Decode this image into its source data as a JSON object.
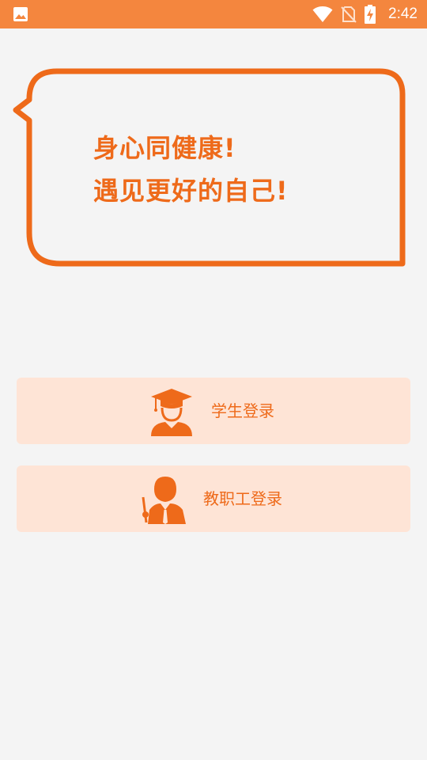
{
  "status_bar": {
    "time": "2:42",
    "icons": [
      "image-icon",
      "wifi-icon",
      "no-sim-icon",
      "battery-charging-icon"
    ]
  },
  "slogan": {
    "line1": "身心同健康!",
    "line2": "遇见更好的自己!"
  },
  "login_options": {
    "student_label": "学生登录",
    "staff_label": "教职工登录"
  },
  "colors": {
    "status_bar": "#f4863e",
    "accent": "#ee6a1a",
    "button_bg": "#fee4d6",
    "background": "#f4f4f4"
  }
}
